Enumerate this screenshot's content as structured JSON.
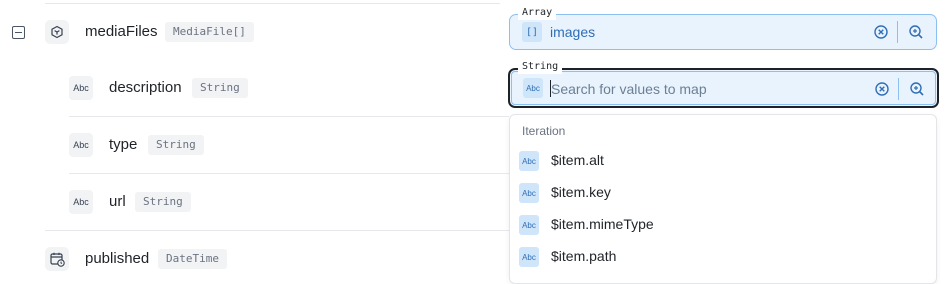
{
  "fields": {
    "media_files": {
      "name": "mediaFiles",
      "type": "MediaFile[]"
    },
    "description": {
      "name": "description",
      "type": "String"
    },
    "type": {
      "name": "type",
      "type": "String"
    },
    "url": {
      "name": "url",
      "type": "String"
    },
    "published": {
      "name": "published",
      "type": "DateTime"
    }
  },
  "icons": {
    "string_icon_text": "Abc"
  },
  "mapping": {
    "array_input": {
      "label": "Array",
      "chip": "[]",
      "value": "images"
    },
    "string_input": {
      "label": "String",
      "chip": "Abc",
      "placeholder": "Search for values to map"
    }
  },
  "dropdown": {
    "header": "Iteration",
    "items": [
      {
        "chip": "Abc",
        "label": "$item.alt"
      },
      {
        "chip": "Abc",
        "label": "$item.key"
      },
      {
        "chip": "Abc",
        "label": "$item.mimeType"
      },
      {
        "chip": "Abc",
        "label": "$item.path"
      }
    ]
  },
  "colors": {
    "accent": "#8cc0f0",
    "input_bg": "#e9f3fd",
    "chip_bg": "#cfe5fa",
    "chip_text": "#2f6eb5"
  }
}
